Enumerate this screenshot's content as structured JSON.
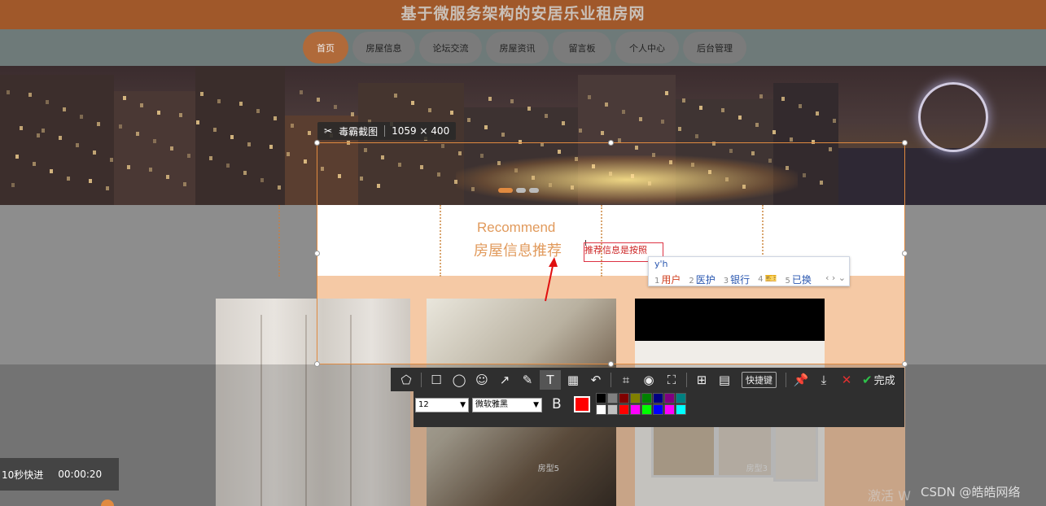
{
  "header": {
    "title": "基于微服务架构的安居乐业租房网"
  },
  "nav": {
    "items": [
      {
        "label": "首页",
        "active": true
      },
      {
        "label": "房屋信息",
        "active": false
      },
      {
        "label": "论坛交流",
        "active": false
      },
      {
        "label": "房屋资讯",
        "active": false
      },
      {
        "label": "留言板",
        "active": false
      },
      {
        "label": "个人中心",
        "active": false
      },
      {
        "label": "后台管理",
        "active": false
      }
    ]
  },
  "section": {
    "subtitle": "Recommend",
    "title": "房屋信息推荐"
  },
  "photos": [
    {
      "label": ""
    },
    {
      "label": "房型5"
    },
    {
      "label": "房型3"
    }
  ],
  "capture": {
    "app_name": "毒霸截图",
    "size": "1059 × 400",
    "text_box_value": "推荐信息是按照",
    "ime": {
      "pinyin": "y'h",
      "candidates": [
        {
          "num": "1",
          "text": "用户"
        },
        {
          "num": "2",
          "text": "医护"
        },
        {
          "num": "3",
          "text": "银行"
        },
        {
          "num": "4",
          "text": "🎫"
        },
        {
          "num": "5",
          "text": "已换"
        }
      ],
      "nav": "‹ › ⌄"
    },
    "toolbar": {
      "shortcut_label": "快捷键",
      "done_label": "完成"
    },
    "text_options": {
      "font_size": "12",
      "font_family": "微软雅黑",
      "bold_label": "B",
      "current_color": "#ff0000",
      "palette": [
        "#000000",
        "#808080",
        "#800000",
        "#808000",
        "#008000",
        "#000080",
        "#800080",
        "#008080",
        "#ffffff",
        "#c0c0c0",
        "#ff0000",
        "#ff00ff",
        "#00ff00",
        "#0000ff",
        "#ff00ff",
        "#00ffff"
      ]
    }
  },
  "timer": {
    "label": "10秒快进",
    "time": "00:00:20"
  },
  "watermark": {
    "activate": "激活 W",
    "csdn": "CSDN @皓皓网络"
  },
  "colors": {
    "header": "#a0582a",
    "nav_active": "#b06a3a",
    "accent": "#e19a5c"
  }
}
